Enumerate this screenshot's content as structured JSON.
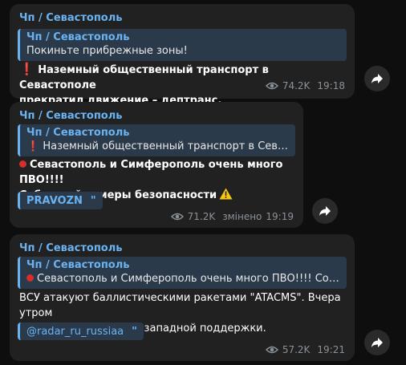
{
  "messages": [
    {
      "sender": "Чп / Севастополь",
      "reply": {
        "sender": "Чп / Севастополь",
        "text": "Покиньте прибрежные зоны!"
      },
      "text_line1": "Наземный общественный транспорт в Севастополе",
      "text_line2": "прекратил движение – дептранс.",
      "views": "74.2K",
      "time": "19:18"
    },
    {
      "sender": "Чп / Севастополь",
      "reply": {
        "sender": "Чп / Севастополь",
        "text": "Наземный общественный транспорт в Севастополе"
      },
      "text_line1": "Севастополь и Симферополь очень много ПВО!!!!",
      "text_line2": "Соблюдайте меры безопасности",
      "tag": "PRAVOZN",
      "views": "71.2K",
      "edited": "змінено",
      "time": "19:19"
    },
    {
      "sender": "Чп / Севастополь",
      "reply": {
        "sender": "Чп / Севастополь",
        "text": "Севастополь и Симферополь очень много ПВО!!!! Соблюдайте меры безопасности"
      },
      "text_line1": "ВСУ атакуют баллистическими ракетами \"ATACMS\". Вчера утром",
      "text_line2": "пришло пополнение с западной поддержки.",
      "tag": "@radar_ru_russiaa",
      "views": "57.2K",
      "time": "19:21"
    }
  ],
  "icons": {
    "exclamation": "❗",
    "quote": "\"\"",
    "colors": {
      "accent": "#6ab3f3",
      "bubble": "#212121",
      "reply_bg": "#2b3a4a",
      "meta": "#8a9299",
      "red": "#e0282e",
      "warning": "#f5c518"
    }
  }
}
